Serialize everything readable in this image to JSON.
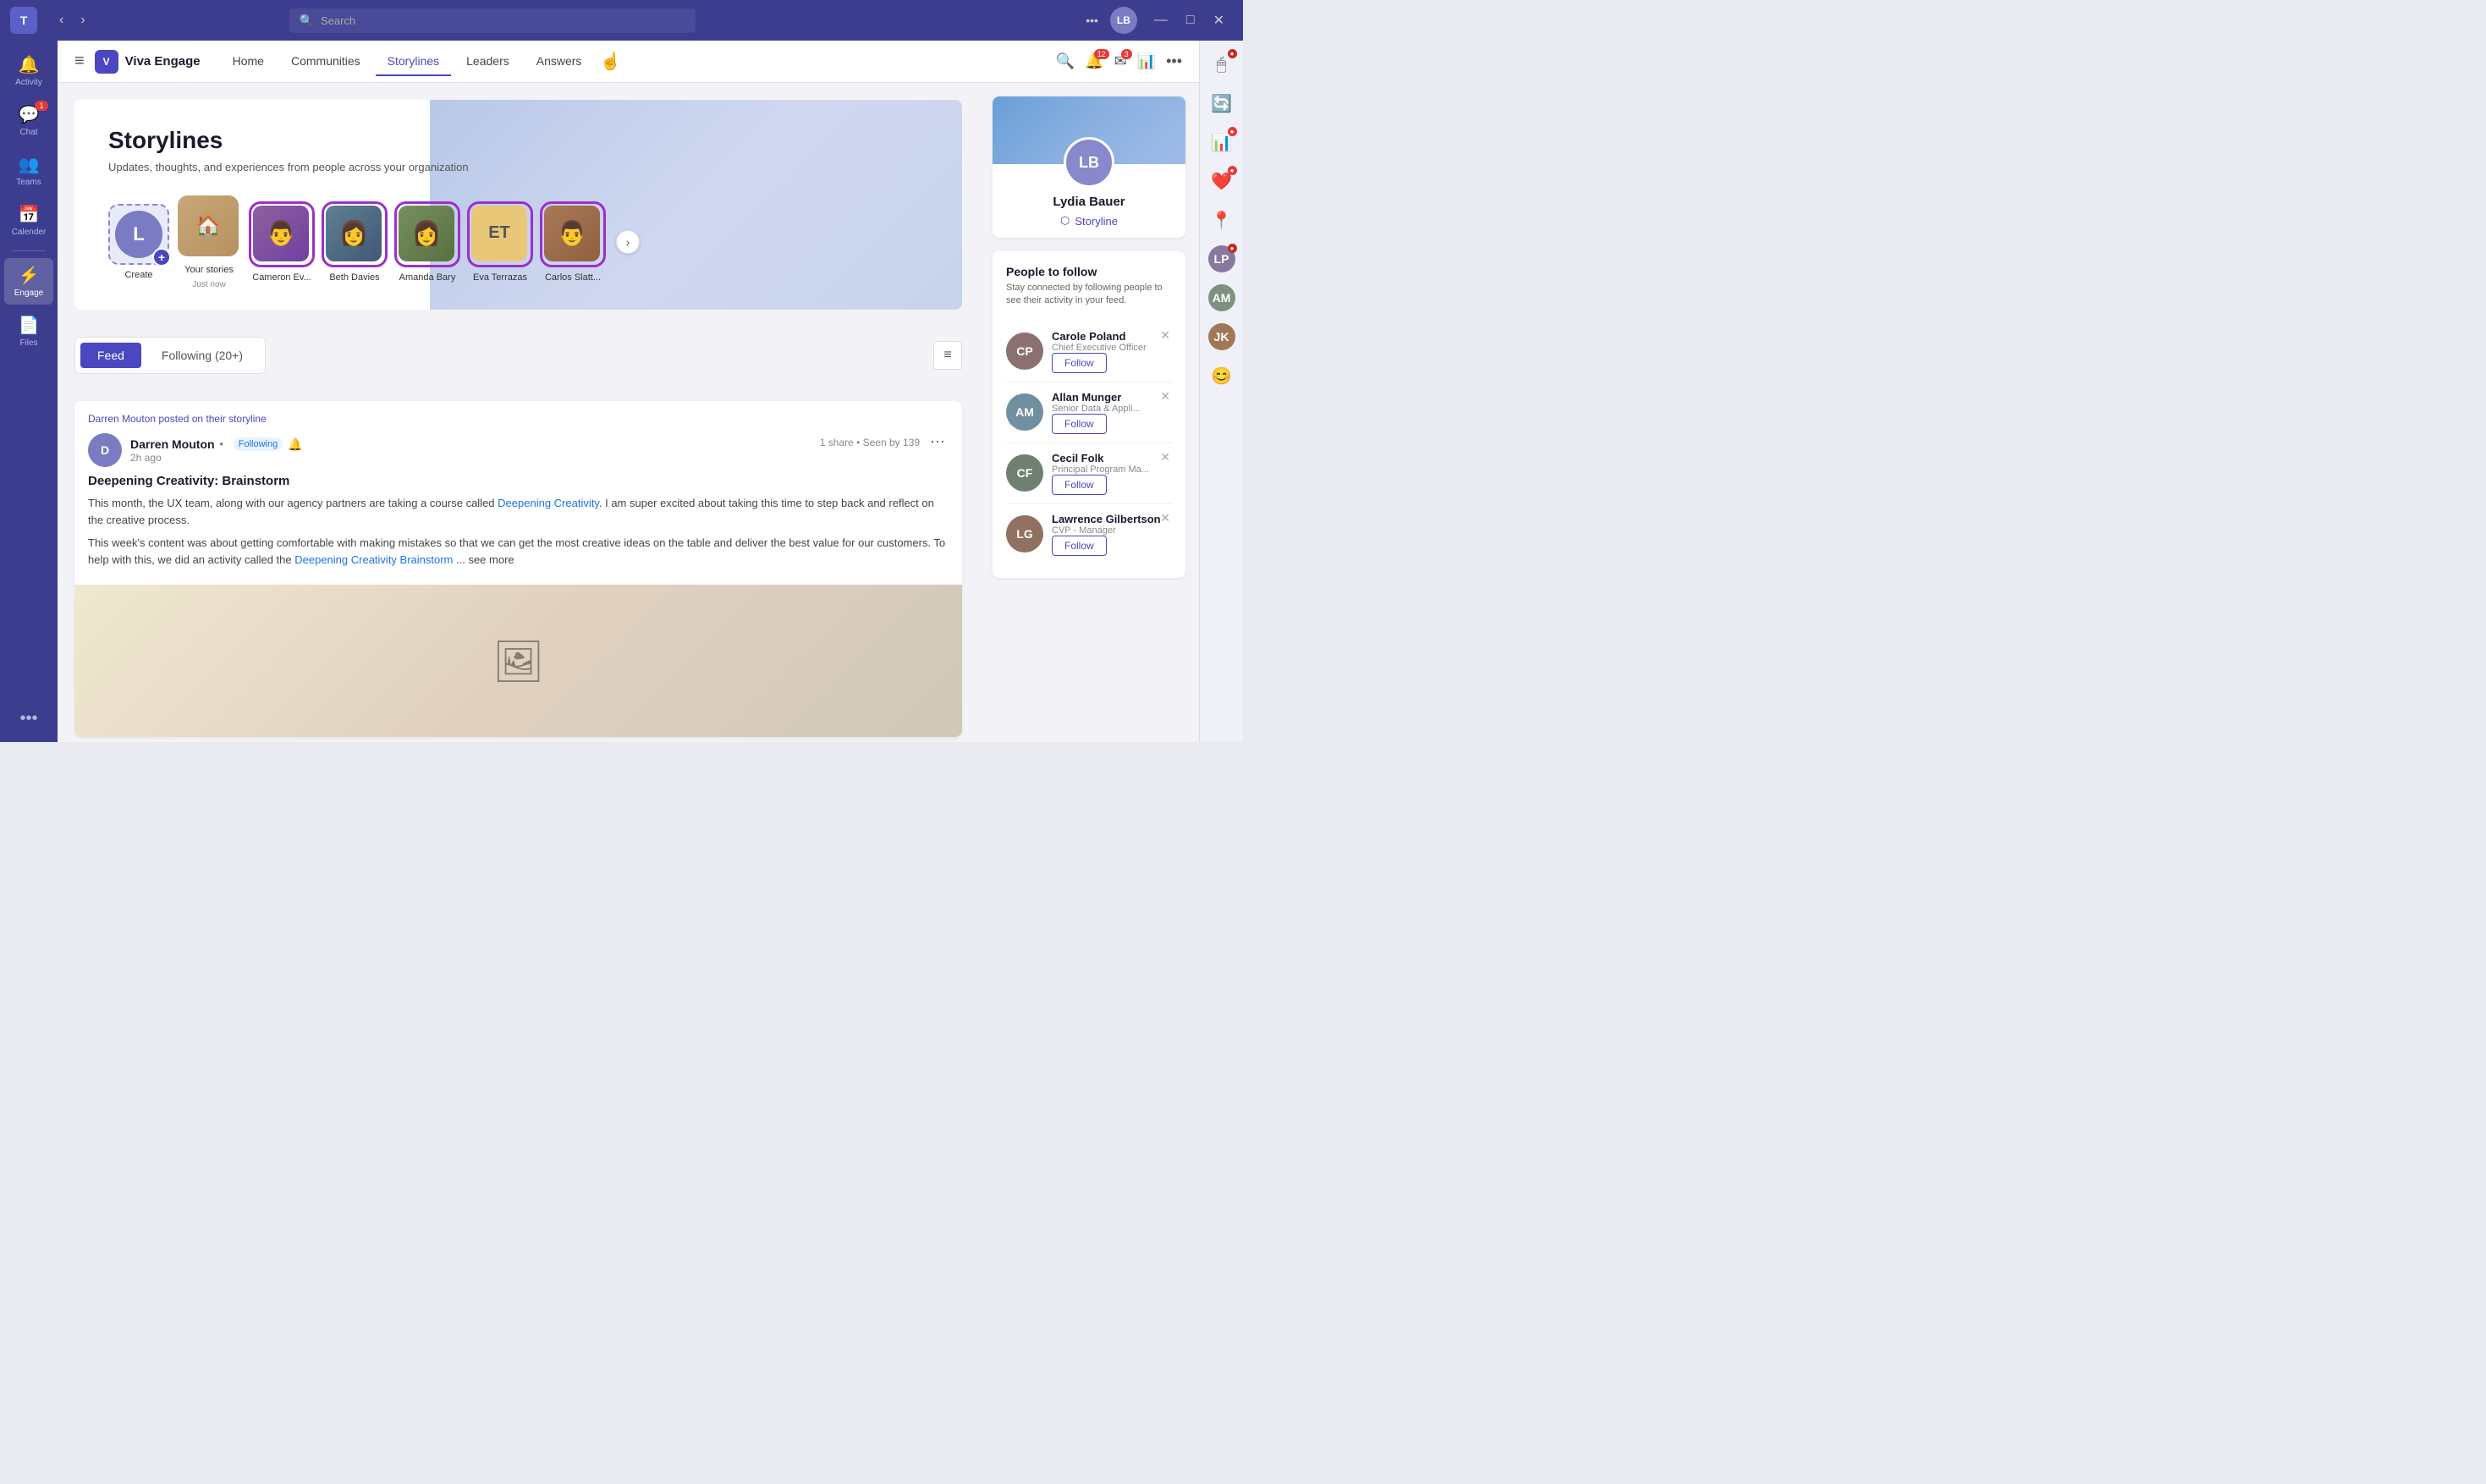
{
  "titleBar": {
    "logoText": "T",
    "searchPlaceholder": "Search",
    "moreLabel": "•••",
    "minimizeLabel": "—",
    "maximizeLabel": "□",
    "closeLabel": "✕"
  },
  "sidebar": {
    "items": [
      {
        "id": "activity",
        "label": "Activity",
        "icon": "🔔",
        "badge": null
      },
      {
        "id": "chat",
        "label": "Chat",
        "icon": "💬",
        "badge": "1"
      },
      {
        "id": "teams",
        "label": "Teams",
        "icon": "👥",
        "badge": null
      },
      {
        "id": "calendar",
        "label": "Calender",
        "icon": "📅",
        "badge": null
      },
      {
        "id": "engage",
        "label": "Engage",
        "icon": "⚡",
        "badge": null,
        "active": true
      },
      {
        "id": "files",
        "label": "Files",
        "icon": "📄",
        "badge": null
      }
    ],
    "moreLabel": "•••"
  },
  "nav": {
    "logoText": "Viva Engage",
    "menuIcon": "≡",
    "items": [
      {
        "id": "home",
        "label": "Home",
        "active": false
      },
      {
        "id": "communities",
        "label": "Communities",
        "active": false
      },
      {
        "id": "storylines",
        "label": "Storylines",
        "active": true
      },
      {
        "id": "leaders",
        "label": "Leaders",
        "active": false
      },
      {
        "id": "answers",
        "label": "Answers",
        "active": false
      }
    ],
    "searchIcon": "🔍",
    "bellIcon": "🔔",
    "bellBadge": "12",
    "msgIcon": "✉",
    "msgBadge": "3",
    "chartIcon": "📊",
    "moreIcon": "•••"
  },
  "hero": {
    "title": "Storylines",
    "subtitle": "Updates, thoughts, and experiences from people across your organization"
  },
  "stories": {
    "createLabel": "Create",
    "items": [
      {
        "id": "yours",
        "label": "Your stories",
        "sublabel": "Just now",
        "type": "yours",
        "bgClass": "bg1"
      },
      {
        "id": "cameron",
        "label": "Cameron Ev...",
        "type": "person",
        "bgClass": "bg2"
      },
      {
        "id": "beth",
        "label": "Beth Davies",
        "type": "person",
        "bgClass": "bg3"
      },
      {
        "id": "amanda",
        "label": "Amanda Bary",
        "type": "person",
        "bgClass": "bg4"
      },
      {
        "id": "eva",
        "label": "Eva Terrazas",
        "type": "initials",
        "initials": "ET",
        "bgClass": "bg-et"
      },
      {
        "id": "carlos",
        "label": "Carlos Slatt...",
        "type": "person",
        "bgClass": "bg5"
      }
    ]
  },
  "feedTabs": {
    "tabs": [
      {
        "id": "feed",
        "label": "Feed",
        "active": true
      },
      {
        "id": "following",
        "label": "Following (20+)",
        "active": false
      }
    ],
    "filterIcon": "≡"
  },
  "post": {
    "metaLine": "Darren Mouton posted on their storyline",
    "authorName": "Darren Mouton",
    "followingLabel": "Following",
    "timeAgo": "2h ago",
    "stats": "1 share • Seen by 139",
    "title": "Deepening Creativity: Brainstorm",
    "bodyPart1": "This month, the UX team, along with our agency partners are taking a course called ",
    "link1": "Deepening Creativity",
    "bodyPart2": ". I am super excited about taking this time to step back and reflect on the creative process.",
    "bodyPart3": "This week's content was about getting comfortable with making mistakes so that we can get the most creative ideas on the table and deliver the best value for our customers. To help with this, we did an activity called the ",
    "link2": "Deepening Creativity Brainstorm",
    "bodyPart4": " ... see more"
  },
  "profile": {
    "name": "Lydia Bauer",
    "storylineLabel": "Storyline"
  },
  "peopleToFollow": {
    "title": "People to follow",
    "subtitle": "Stay connected by following people to see their activity in your feed.",
    "followLabel": "Follow",
    "people": [
      {
        "id": "carole",
        "name": "Carole Poland",
        "role": "Chief Executive Officer",
        "initials": "CP",
        "bgColor": "#8a7070"
      },
      {
        "id": "allan",
        "name": "Allan Munger",
        "role": "Senior Data & Appli...",
        "initials": "AM",
        "bgColor": "#7090a0"
      },
      {
        "id": "cecil",
        "name": "Cecil Folk",
        "role": "Principal Program Ma...",
        "initials": "CF",
        "bgColor": "#708070"
      },
      {
        "id": "lawrence",
        "name": "Lawrence Gilbertson",
        "role": "CVP - Manager",
        "initials": "LG",
        "bgColor": "#907060"
      }
    ]
  },
  "rightPanel": {
    "items": [
      {
        "id": "cursor",
        "icon": "🖱"
      },
      {
        "id": "refresh",
        "icon": "🔄"
      },
      {
        "id": "chart",
        "icon": "📊"
      },
      {
        "id": "heart",
        "icon": "❤️"
      },
      {
        "id": "location",
        "icon": "📍"
      },
      {
        "id": "person1",
        "icon": "👤"
      },
      {
        "id": "person2",
        "icon": "👤"
      },
      {
        "id": "person3",
        "icon": "👤"
      },
      {
        "id": "smiley",
        "icon": "😊"
      }
    ]
  }
}
